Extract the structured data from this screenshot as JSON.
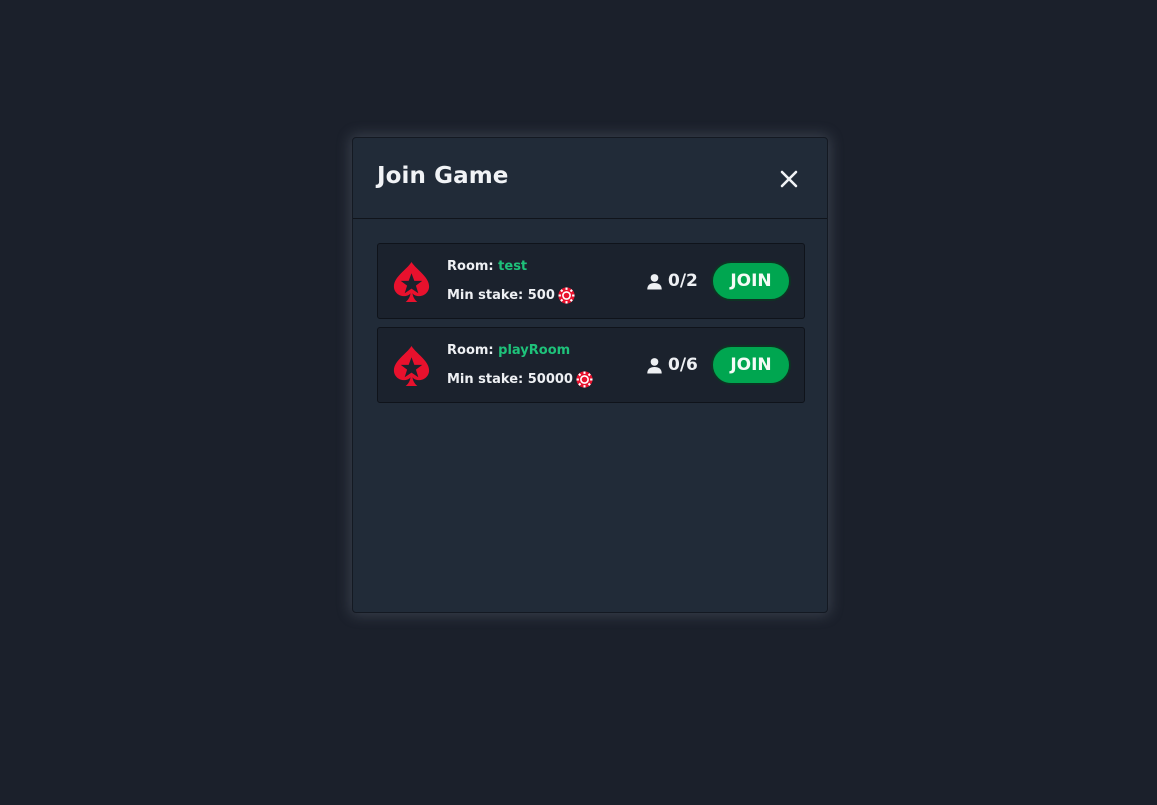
{
  "modal": {
    "title": "Join Game",
    "close_icon": "close-icon"
  },
  "colors": {
    "background": "#1b202b",
    "modal": "#212b38",
    "room_card": "#1b222d",
    "accent_green": "#1ec27a",
    "join_button": "#00a650",
    "brand_red": "#e8112d"
  },
  "rooms": [
    {
      "room_label": "Room: ",
      "room_name": "test",
      "stake_label": "Min stake: 500",
      "players": "0/2",
      "join_label": "JOIN",
      "logo_icon": "spade-star-icon",
      "chip_icon": "poker-chip-icon",
      "user_icon": "user-icon"
    },
    {
      "room_label": "Room: ",
      "room_name": "playRoom",
      "stake_label": "Min stake: 50000",
      "players": "0/6",
      "join_label": "JOIN",
      "logo_icon": "spade-star-icon",
      "chip_icon": "poker-chip-icon",
      "user_icon": "user-icon"
    }
  ]
}
